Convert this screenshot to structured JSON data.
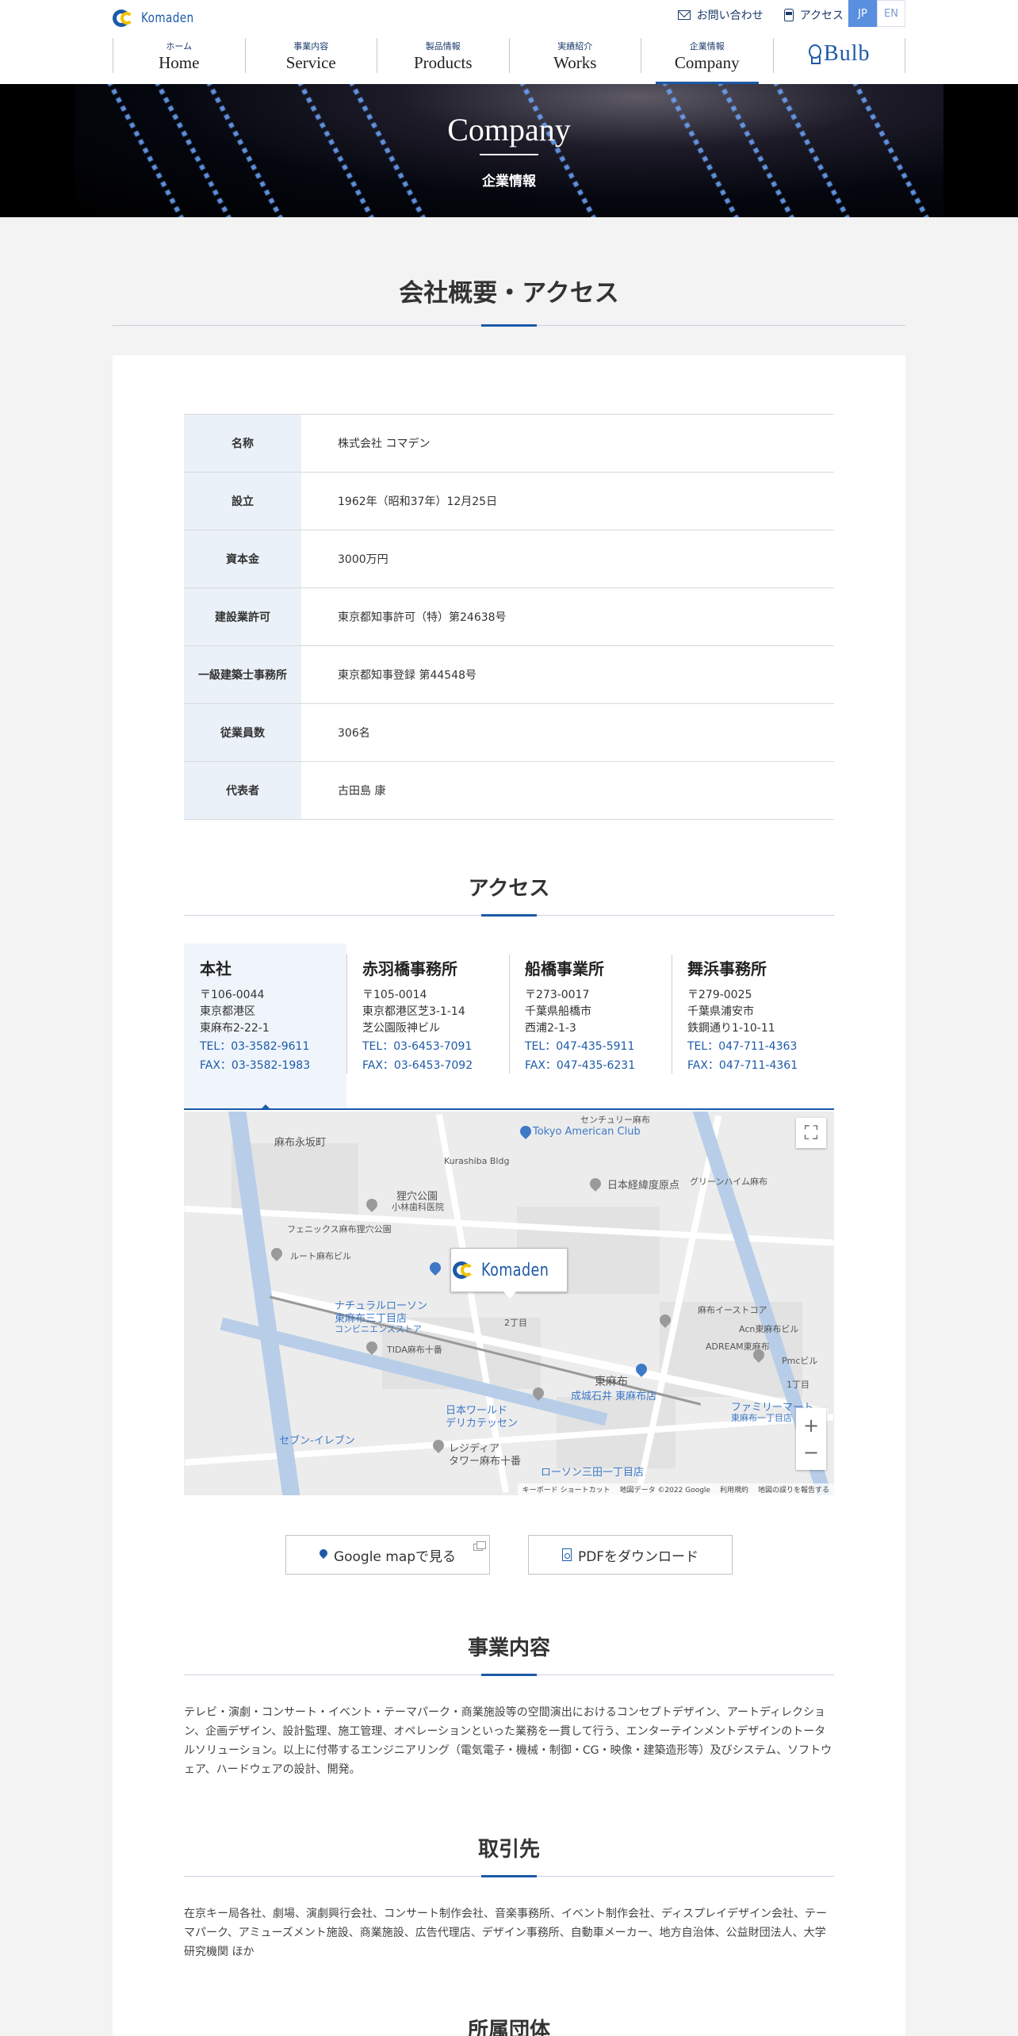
{
  "header": {
    "logo_text": "Komaden",
    "contact_label": "お問い合わせ",
    "access_label": "アクセス",
    "lang_jp": "JP",
    "lang_en": "EN",
    "nav": [
      {
        "jp": "ホーム",
        "en": "Home"
      },
      {
        "jp": "事業内容",
        "en": "Service"
      },
      {
        "jp": "製品情報",
        "en": "Products"
      },
      {
        "jp": "実績紹介",
        "en": "Works"
      },
      {
        "jp": "企業情報",
        "en": "Company"
      }
    ],
    "bulb_label": "Bulb",
    "active_nav": "Company"
  },
  "hero": {
    "title": "Company",
    "subtitle": "企業情報"
  },
  "overview": {
    "title": "会社概要・アクセス",
    "rows": [
      {
        "label": "名称",
        "value": "株式会社 コマデン"
      },
      {
        "label": "設立",
        "value": "1962年（昭和37年）12月25日"
      },
      {
        "label": "資本金",
        "value": "3000万円"
      },
      {
        "label": "建設業許可",
        "value": "東京都知事許可（特）第24638号"
      },
      {
        "label": "一級建築士事務所",
        "value": "東京都知事登録 第44548号"
      },
      {
        "label": "従業員数",
        "value": "306名"
      },
      {
        "label": "代表者",
        "value": "古田島 康"
      }
    ]
  },
  "access": {
    "title": "アクセス",
    "offices": [
      {
        "name": "本社",
        "postal": "〒106-0044",
        "addr1": "東京都港区",
        "addr2": "東麻布2-22-1",
        "tel": "TEL：03-3582-9611",
        "fax": "FAX：03-3582-1983"
      },
      {
        "name": "赤羽橋事務所",
        "postal": "〒105-0014",
        "addr1": "東京都港区芝3-1-14",
        "addr2": "芝公園阪神ビル",
        "tel": "TEL：03-6453-7091",
        "fax": "FAX：03-6453-7092"
      },
      {
        "name": "船橋事業所",
        "postal": "〒273-0017",
        "addr1": "千葉県船橋市",
        "addr2": "西浦2-1-3",
        "tel": "TEL：047-435-5911",
        "fax": "FAX：047-435-6231"
      },
      {
        "name": "舞浜事務所",
        "postal": "〒279-0025",
        "addr1": "千葉県浦安市",
        "addr2": "鉄鋼通り1-10-11",
        "tel": "TEL：047-711-4363",
        "fax": "FAX：047-711-4361"
      }
    ],
    "map": {
      "labels": {
        "azabu_nagasaka": "麻布永坂町",
        "tokyo_american_club": "Tokyo American Club",
        "century": "センチュリー麻布",
        "kurashiba": "Kurashiba Bldg",
        "nihon_keizai": "日本経緯度原点",
        "green_heim": "グリーンハイム麻布",
        "kamaana": "狸穴公園",
        "kobayashi": "小林歯科医院",
        "phoenix": "フェニックス麻布狸穴公園",
        "route_azabu": "ルート麻布ビル",
        "natural_lawson": "ナチュラルローソン",
        "higashi_azabu3": "東麻布三丁目店",
        "convenience": "コンビニエンスストア",
        "tida": "TIDA麻布十番",
        "nichome": "2丁目",
        "higashiazabu": "東麻布",
        "seijo_ishii": "成城石井 東麻布店",
        "family_mart": "ファミリーマート",
        "fm_store": "東麻布一丁目店",
        "seven_eleven": "セブン-イレブン",
        "nihon_world": "日本ワールド",
        "deli": "デリカテッセン",
        "residia": "レジディア",
        "residia2": "タワー麻布十番",
        "lawson_mita": "ローソン三田一丁目店",
        "chome1": "1丁目",
        "azabu_east_court": "麻布イーストコア",
        "acn": "Acn東麻布ビル",
        "adream": "ADREAM東麻布",
        "pmc": "Pmcビル",
        "marker_logo": "Komaden",
        "keyboard": "キーボード ショートカット",
        "data": "地図データ ©2022 Google",
        "terms": "利用規約",
        "report": "地図の誤りを報告する"
      }
    },
    "btn_google": "Google mapで見る",
    "btn_pdf": "PDFをダウンロード"
  },
  "business": {
    "title": "事業内容",
    "text": "テレビ・演劇・コンサート・イベント・テーマパーク・商業施設等の空間演出におけるコンセプトデザイン、アートディレクション、企画デザイン、設計監理、施工管理、オペレーションといった業務を一貫して行う、エンターテインメントデザインのトータルソリューション。以上に付帯するエンジニアリング（電気電子・機械・制御・CG・映像・建築造形等）及びシステム、ソフトウェア、ハードウェアの設計、開発。"
  },
  "clients": {
    "title": "取引先",
    "text": "在京キー局各社、劇場、演劇興行会社、コンサート制作会社、音楽事務所、イベント制作会社、ディスプレイデザイン会社、テーマパーク、アミューズメント施設、商業施設、広告代理店、デザイン事務所、自動車メーカー、地方自治体、公益財団法人、大学研究機関 ほか"
  },
  "affiliations": {
    "title": "所属団体"
  }
}
